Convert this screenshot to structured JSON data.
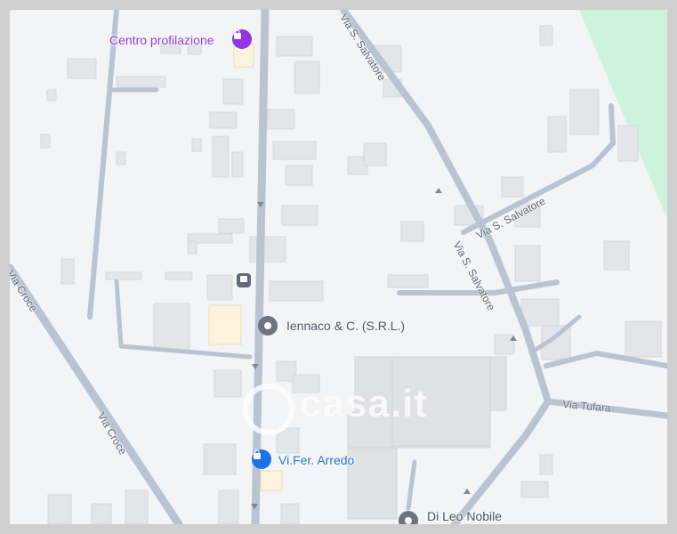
{
  "pois": [
    {
      "label": "Centro profilazione",
      "icon": "shopping-bag-icon",
      "color": "#9334e6"
    },
    {
      "label": "Iennaco & C. (S.R.L.)",
      "icon": "map-pin-icon",
      "color": "#5f6368"
    },
    {
      "label": "Vi.Fer. Arredo",
      "icon": "shopping-bag-icon",
      "color": "#1a73e8"
    },
    {
      "label": "Di Leo Nobile",
      "icon": "map-pin-icon",
      "color": "#5f6368"
    }
  ],
  "streets": {
    "via_salvatore_top": "Via S. Salvatore",
    "via_salvatore_mid": "Via S. Salvatore",
    "via_s_salvatore_upper": "Via S. Salvatore",
    "via_tufara": "Via Tufara",
    "via_croce_left": "Via Croce",
    "via_croce_lower": "Via Croce"
  },
  "watermark": "casa.it",
  "colors": {
    "road": "#b8c4d2",
    "building": "#e3e5e9",
    "park": "#cdf3dc",
    "background": "#f3f4f6"
  }
}
